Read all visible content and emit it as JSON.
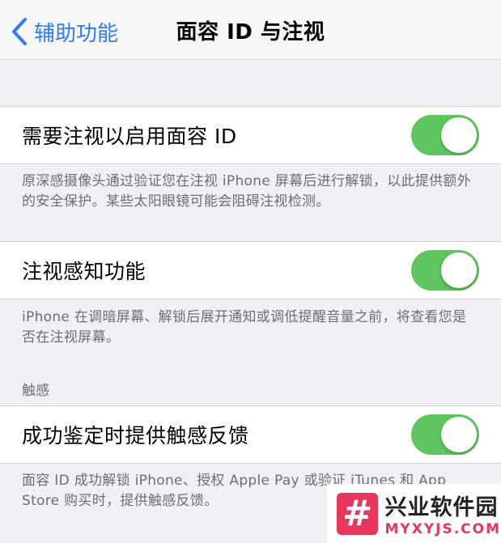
{
  "nav": {
    "back_label": "辅助功能",
    "title": "面容 ID 与注视"
  },
  "rows": [
    {
      "label": "需要注视以启用面容 ID",
      "toggle_on": true,
      "footer": "原深感摄像头通过验证您在注视 iPhone 屏幕后进行解锁，以此提供额外的安全保护。某些太阳眼镜可能会阻碍注视检测。"
    },
    {
      "label": "注视感知功能",
      "toggle_on": true,
      "footer": "iPhone 在调暗屏幕、解锁后展开通知或调低提醒音量之前，将查看您是否在注视屏幕。"
    }
  ],
  "haptics": {
    "header": "触感",
    "label": "成功鉴定时提供触感反馈",
    "toggle_on": true,
    "footer": "面容 ID 成功解锁 iPhone、授权 Apple Pay 或验证 iTunes 和 App Store 购买时，提供触感反馈。"
  },
  "colors": {
    "accent": "#2f7cf6",
    "toggle_on": "#5fc55f",
    "background": "#efeff4"
  },
  "watermark": {
    "logo_glyph": "#",
    "name": "兴业软件园",
    "domain": "MYXYJS.COM"
  }
}
